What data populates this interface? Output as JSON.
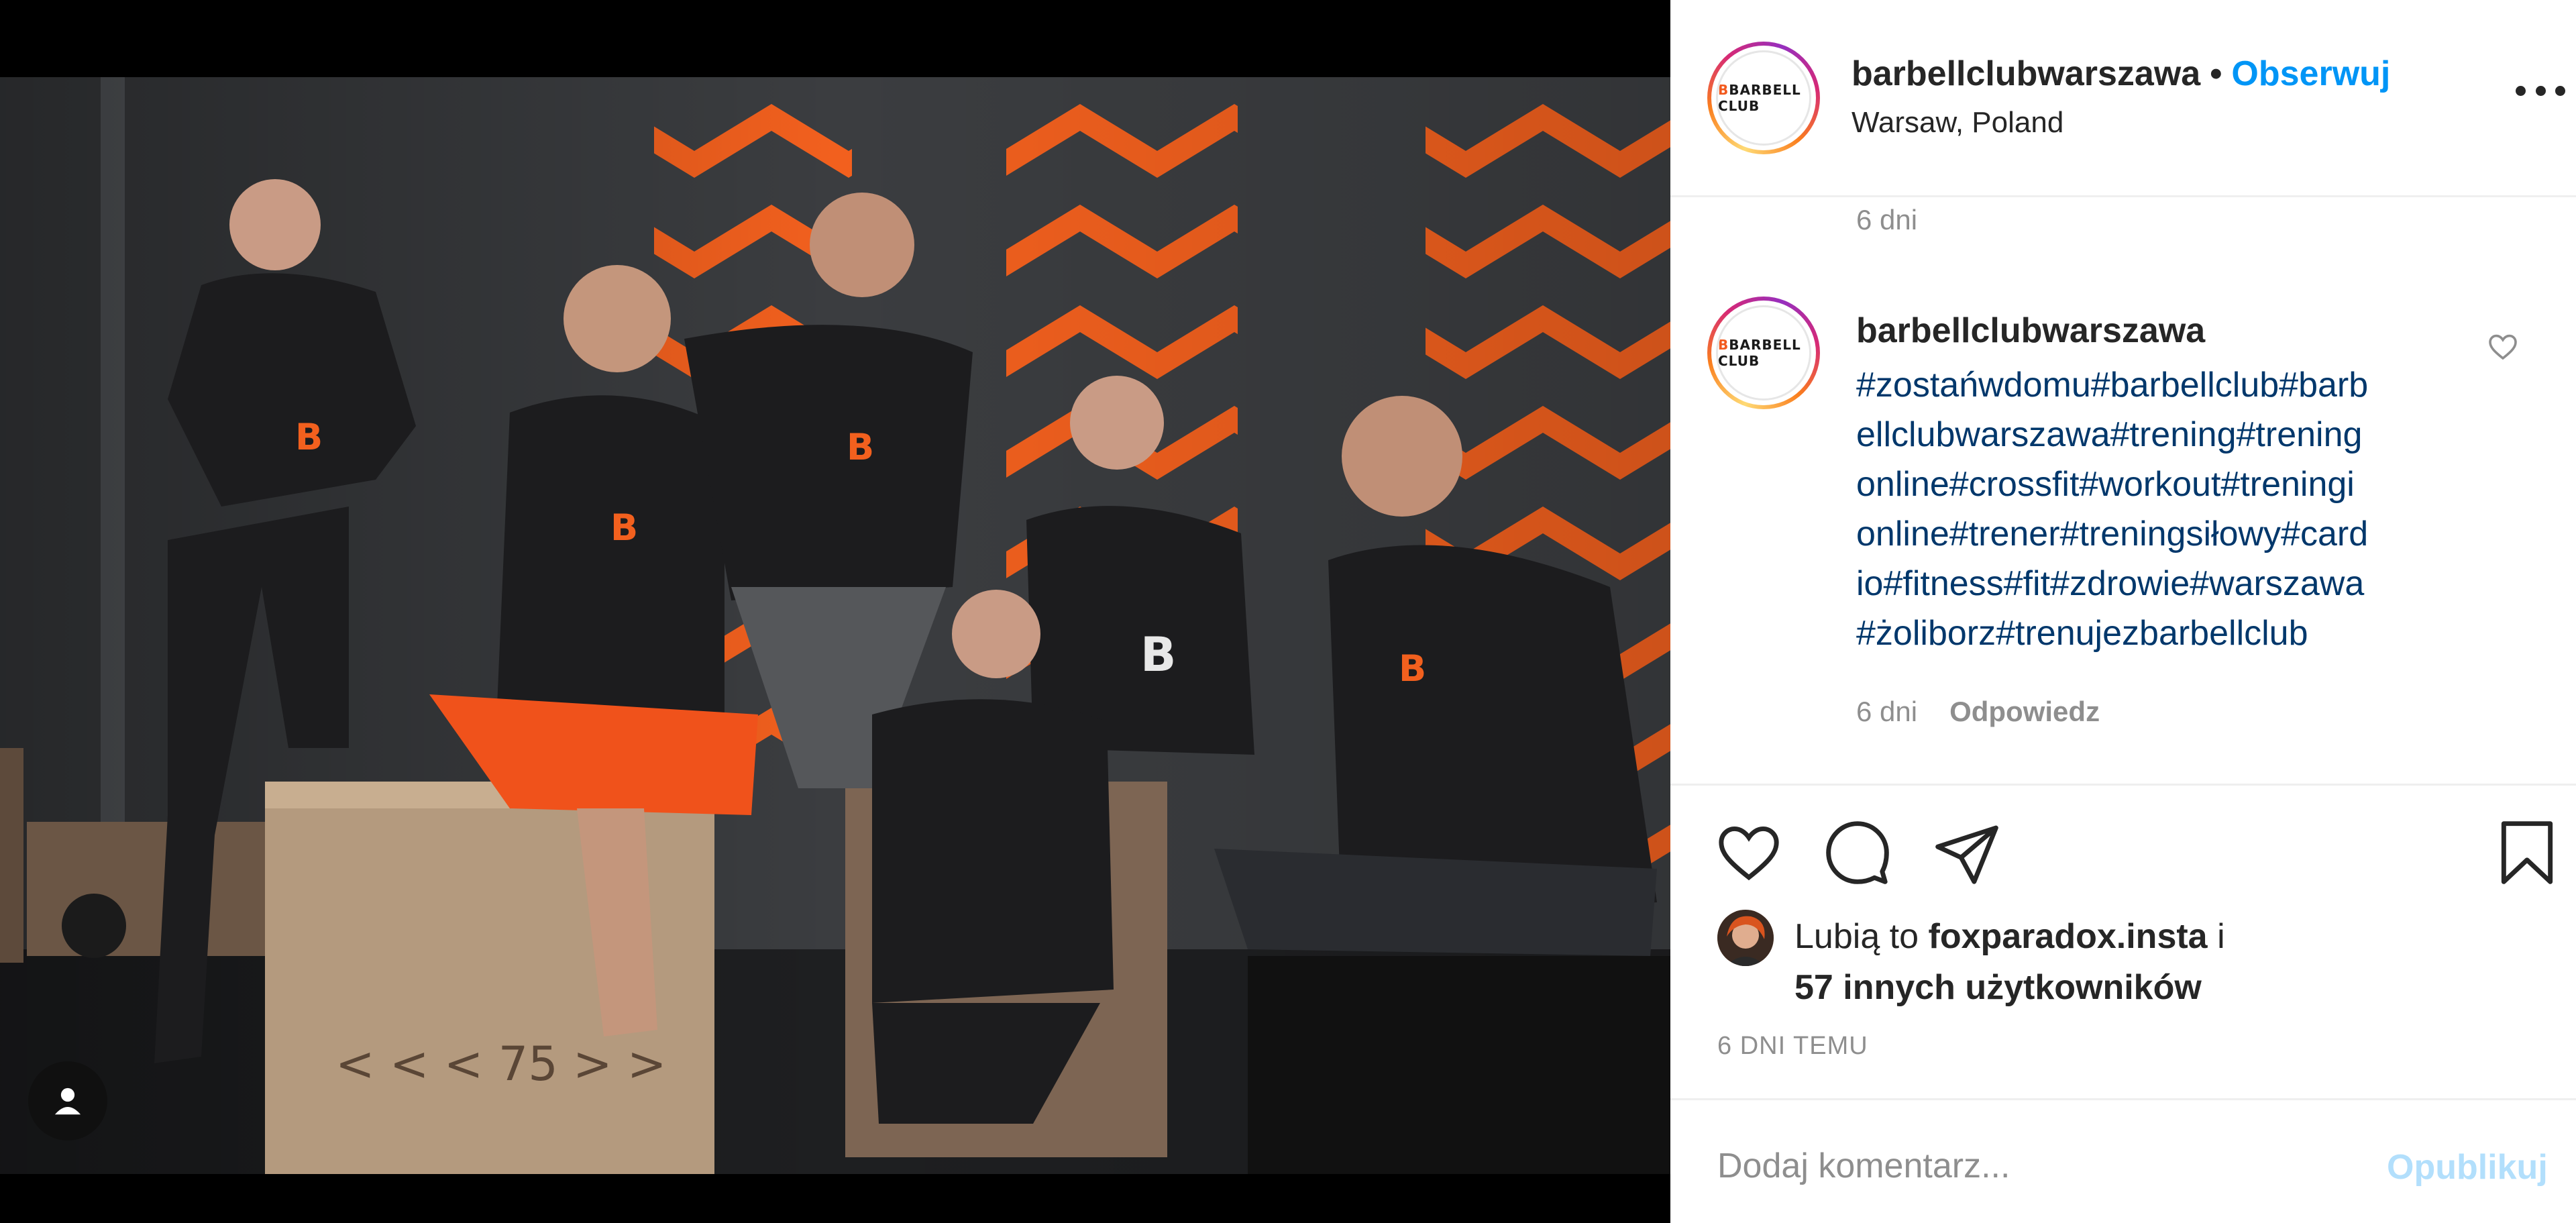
{
  "post": {
    "username": "barbellclubwarszawa",
    "follow_label": "Obserwuj",
    "location": "Warsaw, Poland",
    "separator": "•",
    "logo_text": "BARBELL CLUB"
  },
  "comments": {
    "previous_time": "6 dni",
    "caption_username": "barbellclubwarszawa",
    "caption_lines": [
      "#zostańwdomu#barbellclub#barb",
      "ellclubwarszawa#trening#trening",
      "online#crossfit#workout#treningi",
      "online#trener#treningsiłowy#card",
      "io#fitness#fit#zdrowie#warszawa",
      "#żoliborz#trenujezbarbellclub"
    ],
    "caption_time": "6 dni",
    "reply_label": "Odpowiedz"
  },
  "likes": {
    "prefix": "Lubią to",
    "liker": "foxparadox.insta",
    "conj": "i",
    "others": "57 innych użytkowników"
  },
  "post_time": "6 DNI TEMU",
  "comment_box": {
    "placeholder": "Dodaj komentarz...",
    "publish_label": "Opublikuj"
  },
  "colors": {
    "accent_blue": "#0095f6",
    "hashtag_blue": "#00376b",
    "publish_disabled": "#b2dffc",
    "muted": "#8e8e8e",
    "wall_orange": "#f2601e"
  },
  "icons": [
    "user-tag-icon",
    "more-options-icon",
    "heart-icon",
    "comment-icon",
    "share-icon",
    "bookmark-icon",
    "comment-like-icon"
  ]
}
